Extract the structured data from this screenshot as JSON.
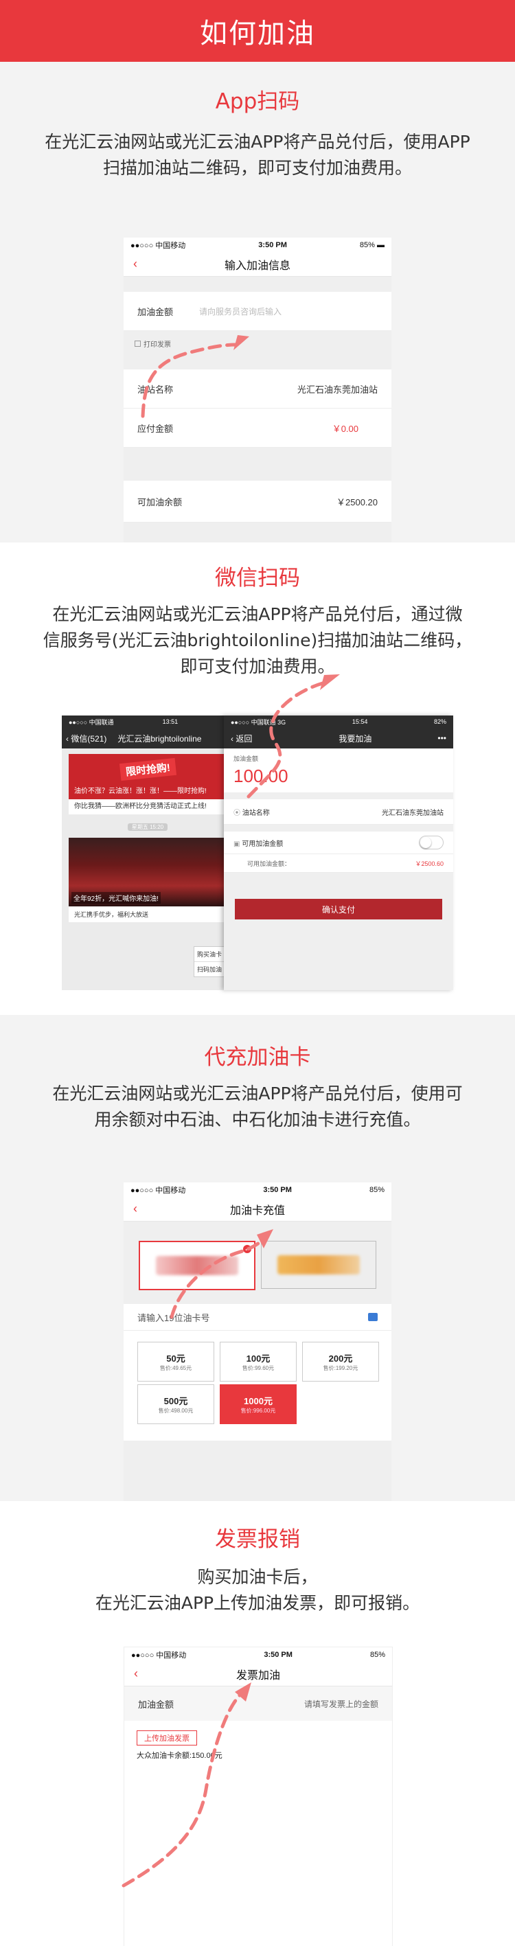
{
  "header": {
    "title": "如何加油"
  },
  "app": {
    "title": "App扫码",
    "desc_line1": "在光汇云油网站或光汇云油APP将产品兑付后，使用APP",
    "desc_line2": "扫描加油站二维码，即可支付加油费用。",
    "phone": {
      "carrier": "●●○○○ 中国移动",
      "time": "3:50 PM",
      "battery": "85%",
      "nav_title": "输入加油信息",
      "amount_label": "加油金额",
      "amount_placeholder": "请向服务员咨询后输入",
      "print_invoice": "打印发票",
      "station_label": "油站名称",
      "station_value": "光汇石油东莞加油站",
      "payable_label": "应付金额",
      "payable_value": "￥0.00",
      "balance_label": "可加油余额",
      "balance_value": "￥2500.20"
    }
  },
  "wechat": {
    "title": "微信扫码",
    "desc_line1": "在光汇云油网站或光汇云油APP将产品兑付后，通过微",
    "desc_line2": "信服务号(光汇云油brightoilonline)扫描加油站二维码，",
    "desc_line3": "即可支付加油费用。",
    "left": {
      "carrier": "●●○○○ 中国联通",
      "time": "13:51",
      "back": "微信(521)",
      "nav_title": "光汇云油brightoilonline",
      "banner_text": "限时抢购!",
      "msg1": "油价不涨？云油涨！涨！涨！——限时抢购!",
      "msg2": "你比我猜——欧洲杯比分竞猜活动正式上线!",
      "time_label": "星期五 15:20",
      "caption": "全年92折，光汇喊你来加油!",
      "msg3": "光汇携手优步，福利大放送",
      "menu1": "购买油卡",
      "menu2": "扫码加油"
    },
    "right": {
      "carrier": "●●○○○ 中国联通  3G",
      "time": "15:54",
      "battery": "82%",
      "back": "返回",
      "nav_title": "我要加油",
      "more": "•••",
      "amount_label": "加油金额",
      "amount_value": "100.00",
      "station_label": "油站名称",
      "station_value": "光汇石油东莞加油站",
      "balance_toggle_label": "可用加油金额",
      "balance_label": "可用加油金额：",
      "balance_value": "￥2500.60",
      "confirm": "确认支付"
    }
  },
  "recharge": {
    "title": "代充加油卡",
    "desc_line1": "在光汇云油网站或光汇云油APP将产品兑付后，使用可",
    "desc_line2": "用余额对中石油、中石化加油卡进行充值。",
    "phone": {
      "carrier": "●●○○○ 中国移动",
      "time": "3:50 PM",
      "battery": "85%",
      "nav_title": "加油卡充值",
      "card_input": "请输入19位油卡号",
      "options": [
        {
          "value": "50元",
          "price": "售价:49.65元"
        },
        {
          "value": "100元",
          "price": "售价:99.60元"
        },
        {
          "value": "200元",
          "price": "售价:199.20元"
        },
        {
          "value": "500元",
          "price": "售价:498.00元"
        },
        {
          "value": "1000元",
          "price": "售价:996.00元"
        }
      ]
    }
  },
  "invoice": {
    "title": "发票报销",
    "desc_line1": "购买加油卡后，",
    "desc_line2": "在光汇云油APP上传加油发票，即可报销。",
    "phone": {
      "carrier": "●●○○○ 中国移动",
      "time": "3:50 PM",
      "battery": "85%",
      "nav_title": "发票加油",
      "amount_label": "加油金额",
      "amount_placeholder": "请填写发票上的金额",
      "upload_button": "上传加油发票",
      "card_balance": "大众加油卡余额:150.00元"
    }
  }
}
